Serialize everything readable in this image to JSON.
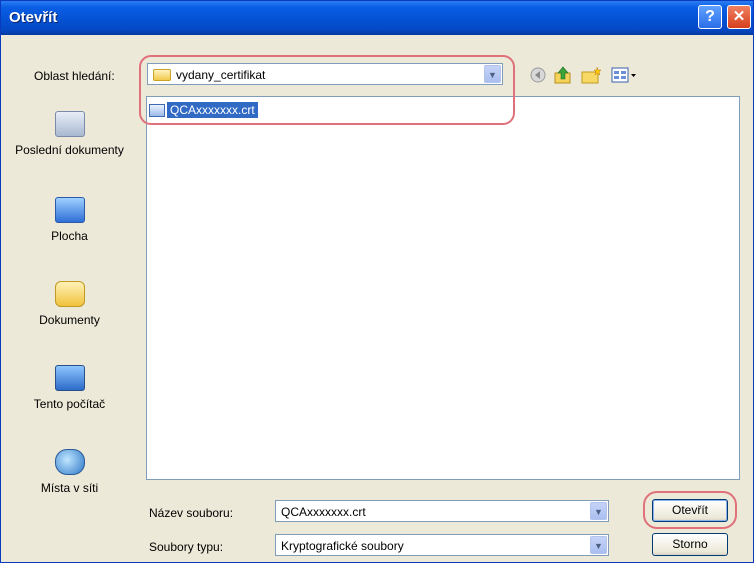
{
  "window": {
    "title": "Otevřít"
  },
  "look_in": {
    "label": "Oblast hledání:",
    "value": "vydany_certifikat"
  },
  "places": [
    {
      "label": "Poslední dokumenty"
    },
    {
      "label": "Plocha"
    },
    {
      "label": "Dokumenty"
    },
    {
      "label": "Tento počítač"
    },
    {
      "label": "Místa v síti"
    }
  ],
  "files": [
    {
      "name": "QCAxxxxxxx.crt",
      "selected": true
    }
  ],
  "filename": {
    "label": "Název souboru:",
    "value": "QCAxxxxxxx.crt"
  },
  "filetype": {
    "label": "Soubory typu:",
    "value": "Kryptografické soubory"
  },
  "buttons": {
    "open": "Otevřít",
    "cancel": "Storno",
    "help": "?",
    "close": "✕"
  },
  "icons": [
    "back-icon",
    "up-folder-icon",
    "new-folder-icon",
    "view-menu-icon"
  ],
  "colors": {
    "titlebar": "#0553d6",
    "selection": "#316ac5",
    "highlight": "#e0707a",
    "face": "#ece9d8"
  }
}
